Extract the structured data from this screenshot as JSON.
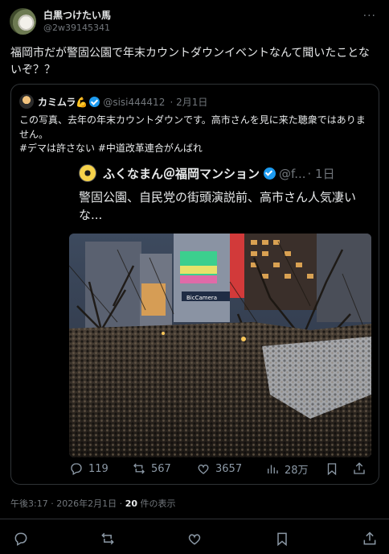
{
  "author": {
    "display_name": "白黒つけたい馬",
    "handle": "@2w39145341"
  },
  "post": {
    "text": "福岡市だが警固公園で年末カウントダウンイベントなんて聞いたことないぞ？？"
  },
  "quoted": {
    "display_name": "カミムラ💪",
    "handle": "@sisi444412",
    "date": "· 2月1日",
    "lines": [
      "この写真、去年の年末カウントダウンです。高市さんを見に来た聴衆ではありません。",
      "#デマは許さない #中道改革連合がんばれ"
    ],
    "inner": {
      "display_name": "ふくなまん＠福岡マンション",
      "handle": "@f...",
      "date": "· 1日",
      "text": "警固公園、自民党の街頭演説前、高市さん人気凄いな..."
    },
    "photo": {
      "sign_text": "BicCamera"
    },
    "actions": {
      "replies": "119",
      "reposts": "567",
      "likes": "3657",
      "views": "28万"
    }
  },
  "meta": {
    "time": "午後3:17 · 2026年2月1日 · ",
    "views_count": "20",
    "views_label": " 件の表示"
  },
  "icons": {
    "reply": "reply-icon",
    "repost": "repost-icon",
    "like": "like-icon",
    "views": "views-icon",
    "bookmark": "bookmark-icon",
    "share": "share-icon",
    "more": "more-icon"
  },
  "colors": {
    "background": "#000000",
    "text": "#e7e9ea",
    "muted": "#71767b",
    "border": "#2f3336",
    "verified": "#1d9bf0"
  }
}
